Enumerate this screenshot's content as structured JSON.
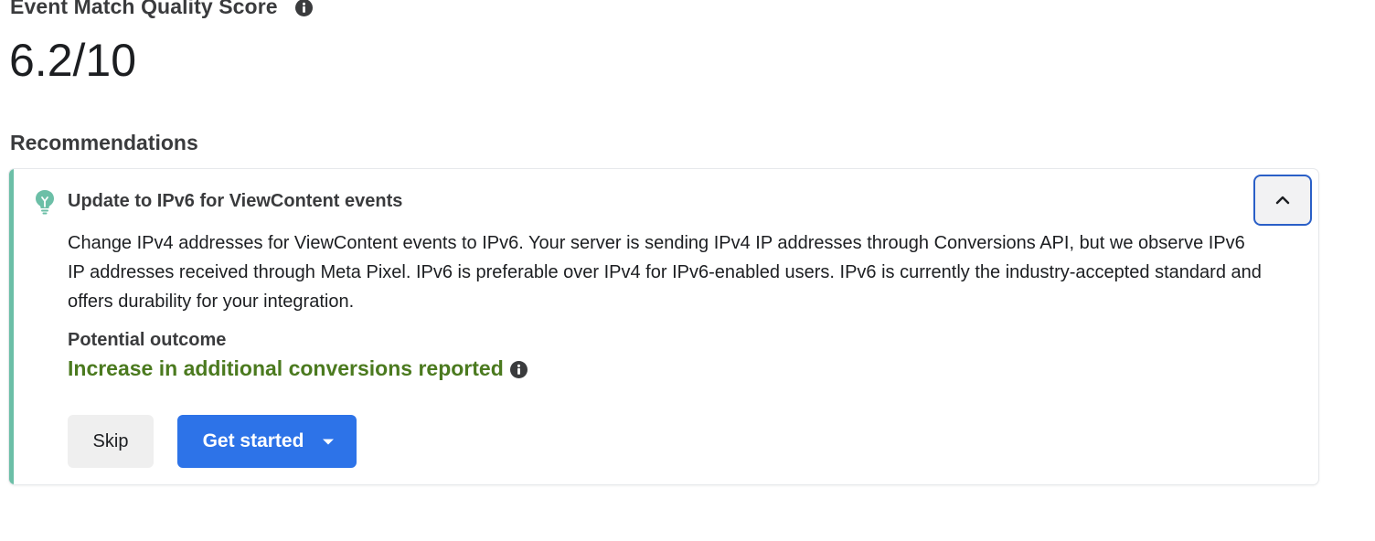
{
  "score": {
    "title": "Event Match Quality Score",
    "value": "6.2/10"
  },
  "recommendations": {
    "title": "Recommendations",
    "card": {
      "title": "Update to IPv6 for ViewContent events",
      "description": "Change IPv4 addresses for ViewContent events to IPv6. Your server is sending IPv4 IP addresses through Conversions API, but we observe IPv6 IP addresses received through Meta Pixel. IPv6 is preferable over IPv4 for IPv6-enabled users. IPv6 is currently the industry-accepted standard and offers durability for your integration.",
      "outcome_label": "Potential outcome",
      "outcome_value": "Increase in additional conversions reported",
      "skip_label": "Skip",
      "get_started_label": "Get started"
    }
  },
  "icons": {
    "info": "info-icon",
    "bulb": "lightbulb-icon",
    "collapse": "chevron-up-icon",
    "dropdown": "caret-down-icon"
  },
  "colors": {
    "accent": "#6cbfa7",
    "primary_button": "#2d73e8",
    "outcome": "#4b7a1f",
    "focus_ring": "#2a5fc7"
  }
}
